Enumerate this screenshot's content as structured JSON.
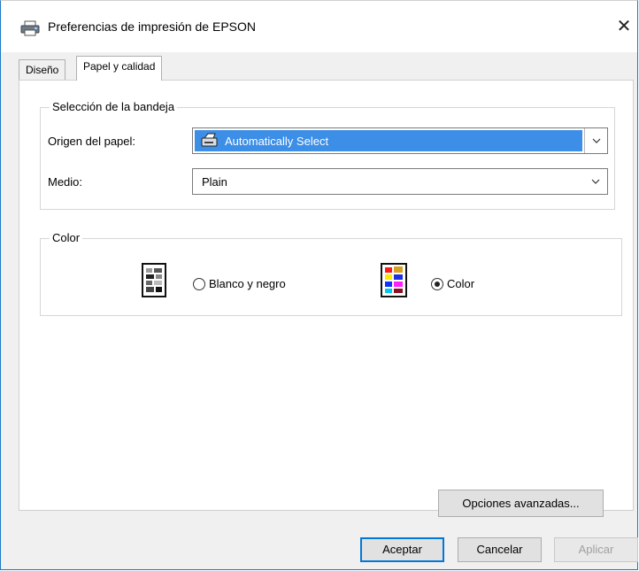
{
  "window": {
    "title": "Preferencias de impresión de EPSON",
    "title_icon": "printer-icon",
    "close_label": "✕"
  },
  "tabs": [
    {
      "label": "Diseño",
      "active": false
    },
    {
      "label": "Papel y calidad",
      "active": true
    }
  ],
  "tray_group": {
    "legend": "Selección de la bandeja",
    "source_label": "Origen del papel:",
    "source_value": "Automatically Select",
    "media_label": "Medio:",
    "media_value": "Plain"
  },
  "color_group": {
    "legend": "Color",
    "options": [
      {
        "label": "Blanco y negro",
        "checked": false,
        "icon": "grayscale-doc-icon"
      },
      {
        "label": "Color",
        "checked": true,
        "icon": "color-doc-icon"
      }
    ]
  },
  "buttons": {
    "advanced": "Opciones avanzadas...",
    "ok": "Aceptar",
    "cancel": "Cancelar",
    "apply": "Aplicar"
  },
  "colors": {
    "selection": "#3c8ee6",
    "window_border": "#1a78c8",
    "default_button_border": "#0078d7"
  }
}
